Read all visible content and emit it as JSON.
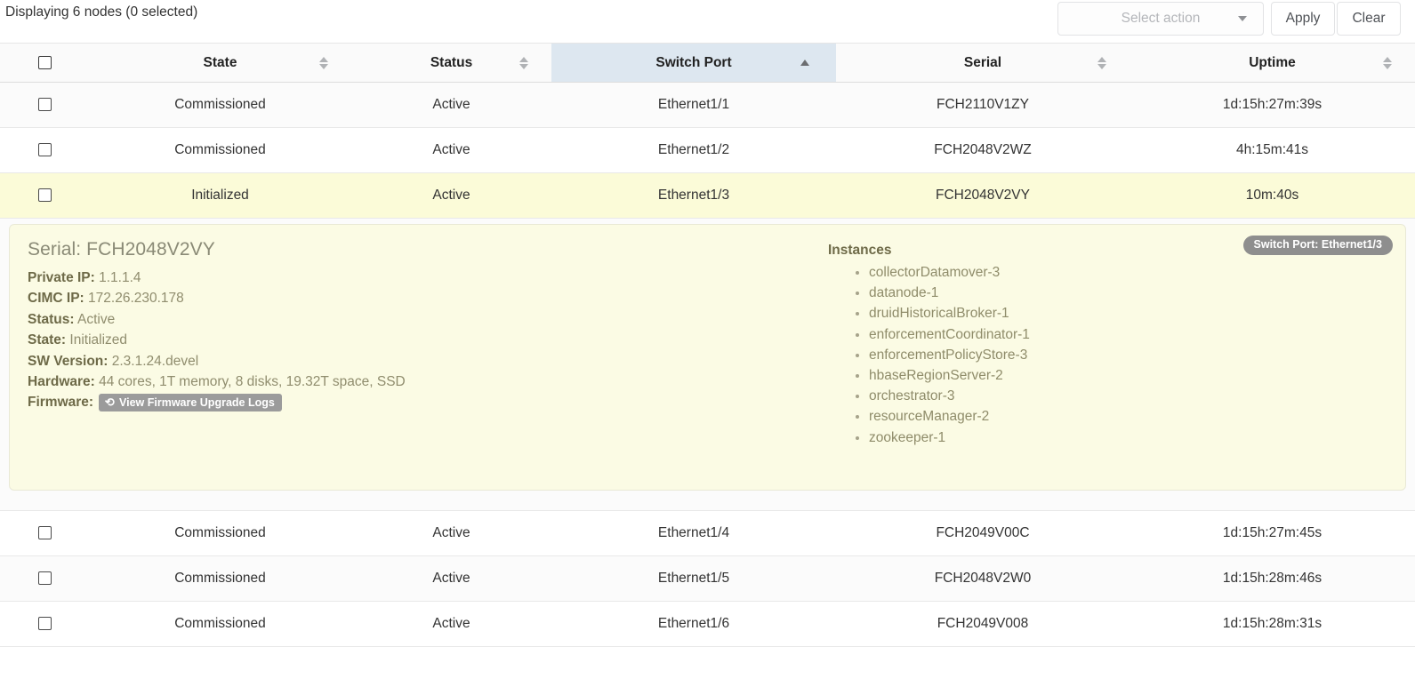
{
  "header": {
    "display_count": "Displaying 6 nodes (0 selected)",
    "select_action_placeholder": "Select action",
    "apply_label": "Apply",
    "clear_label": "Clear"
  },
  "table": {
    "columns": [
      {
        "key": "check",
        "label": "",
        "sorted": false
      },
      {
        "key": "state",
        "label": "State",
        "sorted": false
      },
      {
        "key": "status",
        "label": "Status",
        "sorted": false
      },
      {
        "key": "port",
        "label": "Switch Port",
        "sorted": true,
        "direction": "asc"
      },
      {
        "key": "serial",
        "label": "Serial",
        "sorted": false
      },
      {
        "key": "uptime",
        "label": "Uptime",
        "sorted": false
      }
    ],
    "rows": [
      {
        "state": "Commissioned",
        "status": "Active",
        "port": "Ethernet1/1",
        "serial": "FCH2110V1ZY",
        "uptime": "1d:15h:27m:39s",
        "selected": false,
        "expanded": false
      },
      {
        "state": "Commissioned",
        "status": "Active",
        "port": "Ethernet1/2",
        "serial": "FCH2048V2WZ",
        "uptime": "4h:15m:41s",
        "selected": false,
        "expanded": false
      },
      {
        "state": "Initialized",
        "status": "Active",
        "port": "Ethernet1/3",
        "serial": "FCH2048V2VY",
        "uptime": "10m:40s",
        "selected": false,
        "expanded": true
      },
      {
        "state": "Commissioned",
        "status": "Active",
        "port": "Ethernet1/4",
        "serial": "FCH2049V00C",
        "uptime": "1d:15h:27m:45s",
        "selected": false,
        "expanded": false
      },
      {
        "state": "Commissioned",
        "status": "Active",
        "port": "Ethernet1/5",
        "serial": "FCH2048V2W0",
        "uptime": "1d:15h:28m:46s",
        "selected": false,
        "expanded": false
      },
      {
        "state": "Commissioned",
        "status": "Active",
        "port": "Ethernet1/6",
        "serial": "FCH2049V008",
        "uptime": "1d:15h:28m:31s",
        "selected": false,
        "expanded": false
      }
    ]
  },
  "detail": {
    "title": "Serial: FCH2048V2VY",
    "port_badge": "Switch Port: Ethernet1/3",
    "fields": [
      {
        "label": "Private IP:",
        "value": "1.1.1.4"
      },
      {
        "label": "CIMC IP:",
        "value": "172.26.230.178"
      },
      {
        "label": "Status:",
        "value": "Active"
      },
      {
        "label": "State:",
        "value": "Initialized"
      },
      {
        "label": "SW Version:",
        "value": "2.3.1.24.devel"
      },
      {
        "label": "Hardware:",
        "value": "44 cores, 1T memory, 8 disks, 19.32T space, SSD"
      }
    ],
    "firmware_label": "Firmware:",
    "firmware_button": "View Firmware Upgrade Logs",
    "firmware_button_icon": "history-icon",
    "instances_title": "Instances",
    "instances": [
      "collectorDatamover-3",
      "datanode-1",
      "druidHistoricalBroker-1",
      "enforcementCoordinator-1",
      "enforcementPolicyStore-3",
      "hbaseRegionServer-2",
      "orchestrator-3",
      "resourceManager-2",
      "zookeeper-1"
    ]
  },
  "colors": {
    "sorted_header_bg": "#dde7f0",
    "highlight_row_bg": "#fbfbd8",
    "detail_card_bg": "#fbfbe4",
    "badge_bg": "#8e8e8e"
  }
}
